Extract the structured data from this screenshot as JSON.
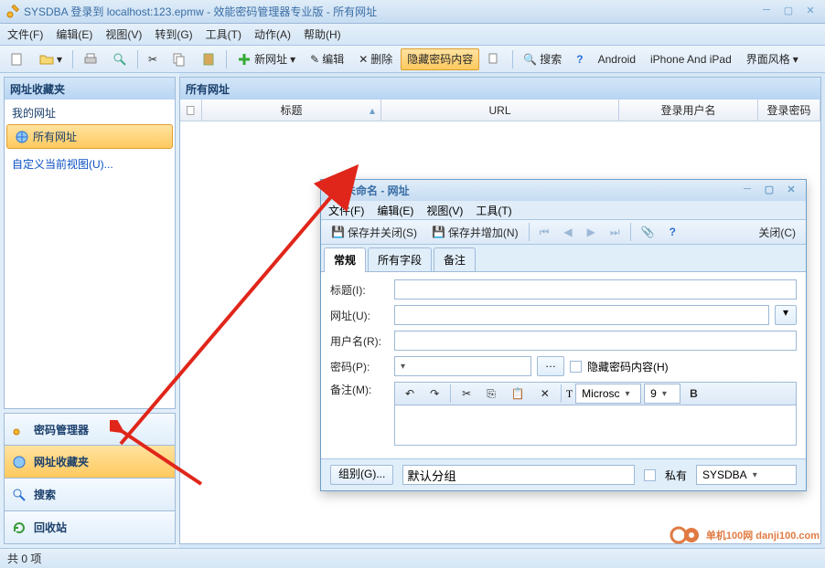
{
  "window": {
    "title": "SYSDBA 登录到 localhost:123.epmw - 效能密码管理器专业版 - 所有网址"
  },
  "menu": [
    "文件(F)",
    "编辑(E)",
    "视图(V)",
    "转到(G)",
    "工具(T)",
    "动作(A)",
    "帮助(H)"
  ],
  "toolbar": {
    "new_url": "新网址",
    "edit": "编辑",
    "delete": "删除",
    "hide_pw": "隐藏密码内容",
    "search": "搜索",
    "android": "Android",
    "iphone_ipad": "iPhone And iPad",
    "style": "界面风格"
  },
  "sidebar": {
    "panel_title": "网址收藏夹",
    "my_urls": "我的网址",
    "all_urls": "所有网址",
    "custom_view": "自定义当前视图(U)...",
    "sections": [
      "密码管理器",
      "网址收藏夹",
      "搜索",
      "回收站"
    ]
  },
  "grid": {
    "title": "所有网址",
    "cols": [
      "",
      "标题",
      "URL",
      "登录用户名",
      "登录密码"
    ]
  },
  "status": "共 0 项",
  "dialog": {
    "title": "未命名 - 网址",
    "menu": [
      "文件(F)",
      "编辑(E)",
      "视图(V)",
      "工具(T)"
    ],
    "tb": {
      "save_close": "保存并关闭(S)",
      "save_add": "保存并增加(N)",
      "close": "关闭(C)"
    },
    "tabs": [
      "常规",
      "所有字段",
      "备注"
    ],
    "labels": {
      "title": "标题(I):",
      "url": "网址(U):",
      "user": "用户名(R):",
      "pwd": "密码(P):",
      "memo": "备注(M):",
      "hide_pw": "隐藏密码内容(H)"
    },
    "rte": {
      "font": "Microsc",
      "size": "9"
    },
    "footer": {
      "group": "组别(G)...",
      "default_group": "默认分组",
      "private": "私有",
      "owner": "SYSDBA"
    }
  },
  "watermark": "单机100网  danji100.com"
}
